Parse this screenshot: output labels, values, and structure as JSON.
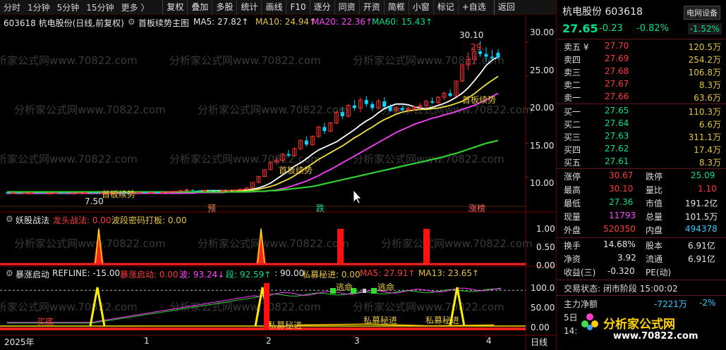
{
  "toolbar": {
    "timeframes": [
      "分时",
      "1分钟",
      "5分钟",
      "15分钟",
      "更多 〉"
    ],
    "buttons": [
      "复权",
      "叠加",
      "多股",
      "统计",
      "画线",
      "F10",
      "逐分",
      "同资",
      "开资",
      "简框",
      "小窗",
      "标记",
      "+自选"
    ],
    "back": "返回"
  },
  "main_panel": {
    "title": "603618 杭电股份(日线,前复权)",
    "indicator_name": "首板续势主图",
    "ma5": "MA5: 27.82↑",
    "ma10": "MA10: 24.94↑",
    "ma20": "MA20: 22.36↑",
    "ma60": "MA60: 15.43↑",
    "y_ticks": [
      "30.00",
      "25.00",
      "20.00",
      "15.00",
      "10.00"
    ],
    "annotations": {
      "high": "30.10",
      "high2": "29.",
      "low": "7.50",
      "signal1": "首板续势",
      "signal2": "首板续势",
      "signal3": "首板续势",
      "mark1": "预",
      "mark2": "跌",
      "mark3": "涨榜"
    }
  },
  "panel2": {
    "title": "妖股战法",
    "l1": "龙头战法: 0.00",
    "l2": "波段密码打板: 0.00",
    "y_ticks": [
      "1.00",
      "0.50",
      "0.00"
    ]
  },
  "panel3": {
    "title": "暴涨启动",
    "refline": "REFLINE: -15.00",
    "baozhang": "暴涨启动: 0.00",
    "bo": "波: 93.24↓",
    "duan": "段: 92.59↑",
    "ninety": ": 90.00",
    "simu": "私募秘进: 0.00",
    "ma5": "MA5: 27.91↑",
    "ma13": "MA13: 23.65↑",
    "y_ticks": [
      "100.0",
      "50.00",
      "0.00"
    ],
    "annotations": {
      "a1": "买底",
      "a2": "私募秘进",
      "a3": "私募秘进",
      "a4": "私募秘进",
      "a5": "逃命",
      "a6": "逃命"
    }
  },
  "x_axis": {
    "labels": [
      "2025年",
      "1",
      "2",
      "3",
      "4"
    ],
    "right_label": "日线"
  },
  "watermark": "分析家公式网www.70822.com",
  "chart_data": {
    "type": "candlestick",
    "title": "603618 杭电股份(日线,前复权)",
    "ylim": [
      6.5,
      31.5
    ],
    "x_labels": [
      "2025年",
      "1",
      "2",
      "3",
      "4"
    ],
    "series": [
      {
        "name": "MA5",
        "color": "#ffffff",
        "values": [
          7.6,
          7.6,
          7.6,
          7.6,
          7.6,
          7.6,
          7.6,
          7.6,
          7.6,
          7.6,
          7.6,
          7.6,
          7.6,
          7.6,
          7.6,
          7.6,
          7.6,
          7.6,
          7.6,
          7.6,
          7.6,
          7.6,
          7.6,
          7.7,
          7.7,
          7.7,
          7.7,
          7.7,
          7.7,
          7.7,
          7.8,
          7.8,
          7.9,
          8.0,
          8.0,
          8.0,
          8.0,
          8.0,
          8.0,
          8.0,
          8.1,
          8.2,
          8.4,
          8.7,
          9.1,
          9.7,
          10.3,
          10.9,
          11.6,
          12.1,
          12.7,
          13.4,
          14.0,
          14.4,
          14.8,
          15.2,
          15.8,
          16.4,
          17.0,
          17.7,
          18.3,
          18.8,
          19.5,
          20.1,
          20.5,
          20.8,
          20.8,
          20.7,
          20.4,
          20.2,
          20.1,
          20.3,
          20.6,
          20.9,
          21.3,
          21.8,
          22.4,
          23.2,
          24.2,
          25.3,
          26.5,
          27.3,
          27.8
        ]
      },
      {
        "name": "MA10",
        "color": "#f0e040",
        "values": [
          7.6,
          7.6,
          7.6,
          7.6,
          7.6,
          7.6,
          7.6,
          7.6,
          7.6,
          7.6,
          7.6,
          7.6,
          7.6,
          7.6,
          7.6,
          7.6,
          7.6,
          7.6,
          7.6,
          7.6,
          7.6,
          7.6,
          7.6,
          7.6,
          7.6,
          7.6,
          7.6,
          7.6,
          7.6,
          7.6,
          7.7,
          7.7,
          7.8,
          7.8,
          7.9,
          7.9,
          7.9,
          8.0,
          8.0,
          8.0,
          8.0,
          8.1,
          8.2,
          8.4,
          8.6,
          8.9,
          9.3,
          9.7,
          10.2,
          10.8,
          11.4,
          12.0,
          12.6,
          13.1,
          13.6,
          14.1,
          14.6,
          15.2,
          15.8,
          16.3,
          16.9,
          17.4,
          18.0,
          18.5,
          18.9,
          19.3,
          19.6,
          19.8,
          19.9,
          20.0,
          20.0,
          20.1,
          20.2,
          20.4,
          20.6,
          20.9,
          21.2,
          21.7,
          22.3,
          23.0,
          23.7,
          24.3,
          24.9
        ]
      },
      {
        "name": "MA20",
        "color": "#ff40ff",
        "values": [
          7.6,
          7.6,
          7.6,
          7.6,
          7.6,
          7.6,
          7.6,
          7.6,
          7.6,
          7.6,
          7.6,
          7.6,
          7.6,
          7.6,
          7.6,
          7.6,
          7.6,
          7.6,
          7.6,
          7.6,
          7.6,
          7.6,
          7.6,
          7.6,
          7.6,
          7.6,
          7.6,
          7.6,
          7.6,
          7.6,
          7.6,
          7.6,
          7.7,
          7.7,
          7.7,
          7.7,
          7.7,
          7.8,
          7.8,
          7.8,
          7.8,
          7.8,
          7.9,
          7.9,
          8.0,
          8.1,
          8.3,
          8.5,
          8.8,
          9.1,
          9.4,
          9.8,
          10.2,
          10.7,
          11.1,
          11.6,
          12.1,
          12.6,
          13.1,
          13.6,
          14.1,
          14.6,
          15.1,
          15.6,
          16.1,
          16.6,
          17.0,
          17.4,
          17.8,
          18.1,
          18.4,
          18.7,
          18.9,
          19.2,
          19.4,
          19.7,
          20.0,
          20.3,
          20.6,
          21.0,
          21.4,
          21.9,
          22.4
        ]
      },
      {
        "name": "MA60",
        "color": "#30d030",
        "values": [
          7.8,
          7.8,
          7.8,
          7.8,
          7.8,
          7.8,
          7.8,
          7.8,
          7.8,
          7.8,
          7.8,
          7.8,
          7.8,
          7.8,
          7.8,
          7.8,
          7.8,
          7.8,
          7.8,
          7.8,
          7.8,
          7.8,
          7.8,
          7.8,
          7.8,
          7.8,
          7.8,
          7.8,
          7.8,
          7.8,
          7.8,
          7.8,
          7.8,
          7.8,
          7.8,
          7.8,
          7.8,
          7.8,
          7.8,
          7.8,
          7.8,
          7.9,
          7.9,
          7.9,
          8.0,
          8.0,
          8.1,
          8.2,
          8.3,
          8.4,
          8.5,
          8.6,
          8.8,
          9.0,
          9.2,
          9.4,
          9.6,
          9.8,
          10.0,
          10.2,
          10.4,
          10.6,
          10.8,
          11.0,
          11.2,
          11.4,
          11.6,
          11.8,
          12.0,
          12.2,
          12.4,
          12.6,
          12.8,
          13.0,
          13.3,
          13.5,
          13.8,
          14.1,
          14.4,
          14.7,
          15.0,
          15.2,
          15.4
        ]
      }
    ],
    "candles": [
      [
        7.7,
        7.8,
        7.5,
        7.6
      ],
      [
        7.6,
        7.7,
        7.55,
        7.65
      ],
      [
        7.65,
        7.7,
        7.55,
        7.6
      ],
      [
        7.6,
        7.7,
        7.5,
        7.65
      ],
      [
        7.65,
        7.75,
        7.6,
        7.7
      ],
      [
        7.7,
        7.7,
        7.55,
        7.6
      ],
      [
        7.6,
        7.7,
        7.5,
        7.55
      ],
      [
        7.55,
        7.65,
        7.5,
        7.6
      ],
      [
        7.6,
        7.7,
        7.55,
        7.65
      ],
      [
        7.65,
        7.7,
        7.55,
        7.6
      ],
      [
        7.6,
        7.7,
        7.5,
        7.55
      ],
      [
        7.55,
        7.65,
        7.5,
        7.6
      ],
      [
        7.6,
        7.7,
        7.55,
        7.65
      ],
      [
        7.65,
        7.75,
        7.6,
        7.7
      ],
      [
        7.7,
        7.75,
        7.6,
        7.65
      ],
      [
        7.65,
        7.7,
        7.55,
        7.6
      ],
      [
        7.6,
        7.7,
        7.55,
        7.65
      ],
      [
        7.65,
        7.7,
        7.6,
        7.65
      ],
      [
        7.65,
        7.75,
        7.6,
        7.7
      ],
      [
        7.7,
        7.8,
        7.6,
        7.65
      ],
      [
        7.65,
        7.7,
        7.55,
        7.6
      ],
      [
        7.6,
        7.7,
        7.55,
        7.65
      ],
      [
        7.65,
        7.8,
        7.6,
        7.75
      ],
      [
        7.75,
        7.8,
        7.6,
        7.7
      ],
      [
        7.7,
        7.8,
        7.65,
        7.75
      ],
      [
        7.75,
        7.85,
        7.6,
        7.7
      ],
      [
        7.7,
        7.8,
        7.6,
        7.75
      ],
      [
        7.75,
        7.9,
        7.7,
        7.85
      ],
      [
        7.85,
        8.0,
        7.75,
        7.9
      ],
      [
        7.9,
        8.1,
        7.8,
        8.0
      ],
      [
        8.0,
        8.3,
        7.9,
        8.1
      ],
      [
        8.1,
        8.2,
        7.9,
        8.0
      ],
      [
        8.0,
        8.1,
        7.85,
        7.95
      ],
      [
        7.95,
        8.1,
        7.9,
        8.05
      ],
      [
        8.05,
        8.15,
        7.9,
        8.0
      ],
      [
        8.0,
        8.1,
        7.9,
        7.95
      ],
      [
        7.95,
        8.05,
        7.85,
        8.0
      ],
      [
        8.0,
        8.1,
        7.9,
        8.05
      ],
      [
        8.05,
        8.2,
        7.95,
        8.1
      ],
      [
        8.1,
        8.3,
        8.0,
        8.2
      ],
      [
        8.2,
        8.5,
        8.1,
        8.4
      ],
      [
        8.4,
        9.2,
        8.3,
        9.2
      ],
      [
        9.2,
        10.1,
        9.1,
        10.1
      ],
      [
        10.1,
        11.1,
        10.0,
        11.1
      ],
      [
        11.1,
        12.2,
        11.0,
        12.2
      ],
      [
        12.2,
        13.0,
        11.8,
        12.5
      ],
      [
        12.5,
        13.5,
        12.2,
        13.4
      ],
      [
        13.4,
        14.0,
        12.9,
        13.2
      ],
      [
        13.2,
        14.4,
        13.0,
        14.2
      ],
      [
        14.2,
        15.6,
        14.0,
        15.4
      ],
      [
        15.4,
        16.0,
        14.5,
        14.8
      ],
      [
        14.8,
        16.2,
        14.6,
        16.0
      ],
      [
        16.0,
        17.6,
        15.8,
        17.4
      ],
      [
        17.4,
        18.0,
        16.4,
        16.8
      ],
      [
        16.8,
        18.2,
        16.6,
        18.0
      ],
      [
        18.0,
        19.8,
        17.8,
        19.6
      ],
      [
        19.6,
        20.4,
        18.6,
        19.0
      ],
      [
        19.0,
        20.8,
        18.8,
        20.6
      ],
      [
        20.6,
        21.4,
        19.8,
        20.2
      ],
      [
        20.2,
        21.8,
        19.6,
        21.4
      ],
      [
        21.4,
        22.0,
        20.4,
        20.8
      ],
      [
        20.8,
        21.2,
        19.8,
        20.2
      ],
      [
        20.2,
        21.6,
        20.0,
        21.2
      ],
      [
        21.2,
        21.8,
        20.2,
        20.4
      ],
      [
        20.4,
        20.8,
        19.6,
        19.8
      ],
      [
        19.8,
        20.4,
        19.4,
        20.2
      ],
      [
        20.2,
        20.6,
        19.6,
        19.9
      ],
      [
        19.9,
        20.4,
        19.5,
        20.1
      ],
      [
        20.1,
        20.6,
        19.8,
        20.4
      ],
      [
        20.4,
        21.0,
        20.0,
        20.6
      ],
      [
        20.6,
        21.4,
        20.2,
        21.2
      ],
      [
        21.2,
        21.8,
        20.8,
        21.0
      ],
      [
        21.0,
        22.0,
        20.8,
        21.8
      ],
      [
        21.8,
        22.6,
        21.4,
        22.4
      ],
      [
        22.4,
        23.0,
        21.8,
        22.0
      ],
      [
        22.0,
        24.2,
        21.9,
        24.2
      ],
      [
        24.2,
        26.6,
        24.0,
        26.6
      ],
      [
        26.6,
        28.4,
        25.8,
        27.4
      ],
      [
        27.4,
        29.2,
        26.6,
        28.6
      ],
      [
        28.6,
        30.1,
        27.8,
        28.2
      ],
      [
        28.2,
        29.2,
        27.0,
        27.8
      ],
      [
        27.8,
        28.8,
        27.2,
        27.6
      ],
      [
        28.4,
        28.9,
        27.4,
        27.65
      ]
    ]
  },
  "right_panel": {
    "name": "杭电股份",
    "code": "603618",
    "btn": "电网设备",
    "price": "27.65",
    "change": "-0.23",
    "pct": "-0.82%",
    "pct2": "-1.52%",
    "sell": [
      {
        "n": "卖五 ¥",
        "p": "27.70",
        "v": "120.5万"
      },
      {
        "n": "卖四",
        "p": "27.69",
        "v": "254.2万"
      },
      {
        "n": "卖三",
        "p": "27.68",
        "v": "106.8万"
      },
      {
        "n": "卖二",
        "p": "27.67",
        "v": "8.3万"
      },
      {
        "n": "卖一",
        "p": "27.66",
        "v": "63.6万"
      }
    ],
    "buy": [
      {
        "n": "买一",
        "p": "27.65",
        "v": "110.3万"
      },
      {
        "n": "买二",
        "p": "27.64",
        "v": "6.6万"
      },
      {
        "n": "买三",
        "p": "27.63",
        "v": "311.1万"
      },
      {
        "n": "买四",
        "p": "27.62",
        "v": "17.4万"
      },
      {
        "n": "买五",
        "p": "27.61",
        "v": "8.3万"
      }
    ],
    "stats": {
      "zt_k": "涨停",
      "zt_v": "30.67",
      "dt_k": "跌停",
      "dt_v": "25.09",
      "zg_k": "最高",
      "zg_v": "30.10",
      "lb_k": "量比",
      "lb_v": "1.10",
      "zd_k": "最低",
      "zd_v": "27.36",
      "sz_k": "市值",
      "sz_v": "191.2亿",
      "xl_k": "现量",
      "xl_v": "11793",
      "zl_k": "总量",
      "zl_v": "101.5万",
      "wp_k": "外盘",
      "wp_v": "520350",
      "np_k": "内盘",
      "np_v": "494378",
      "hs_k": "换手",
      "hs_v": "14.68%",
      "gb_k": "股本",
      "gb_v": "6.91亿",
      "jz_k": "净资",
      "jz_v": "3.92",
      "lt_k": "流通",
      "lt_v": "6.91亿",
      "sy_k": "收益(三)",
      "sy_v": "-0.320",
      "pe_k": "PE(动)",
      "pe_v": "—"
    },
    "state_k": "交易状态:",
    "state_v": "闭市阶段 15:00:02",
    "zl_label": "主力净额",
    "zl_val": "-7221万",
    "zl_pct": "-2%",
    "day_label": "5日",
    "time_label": "14:",
    "logo": "分析家公式网",
    "logo_url": "www.70822.com"
  }
}
